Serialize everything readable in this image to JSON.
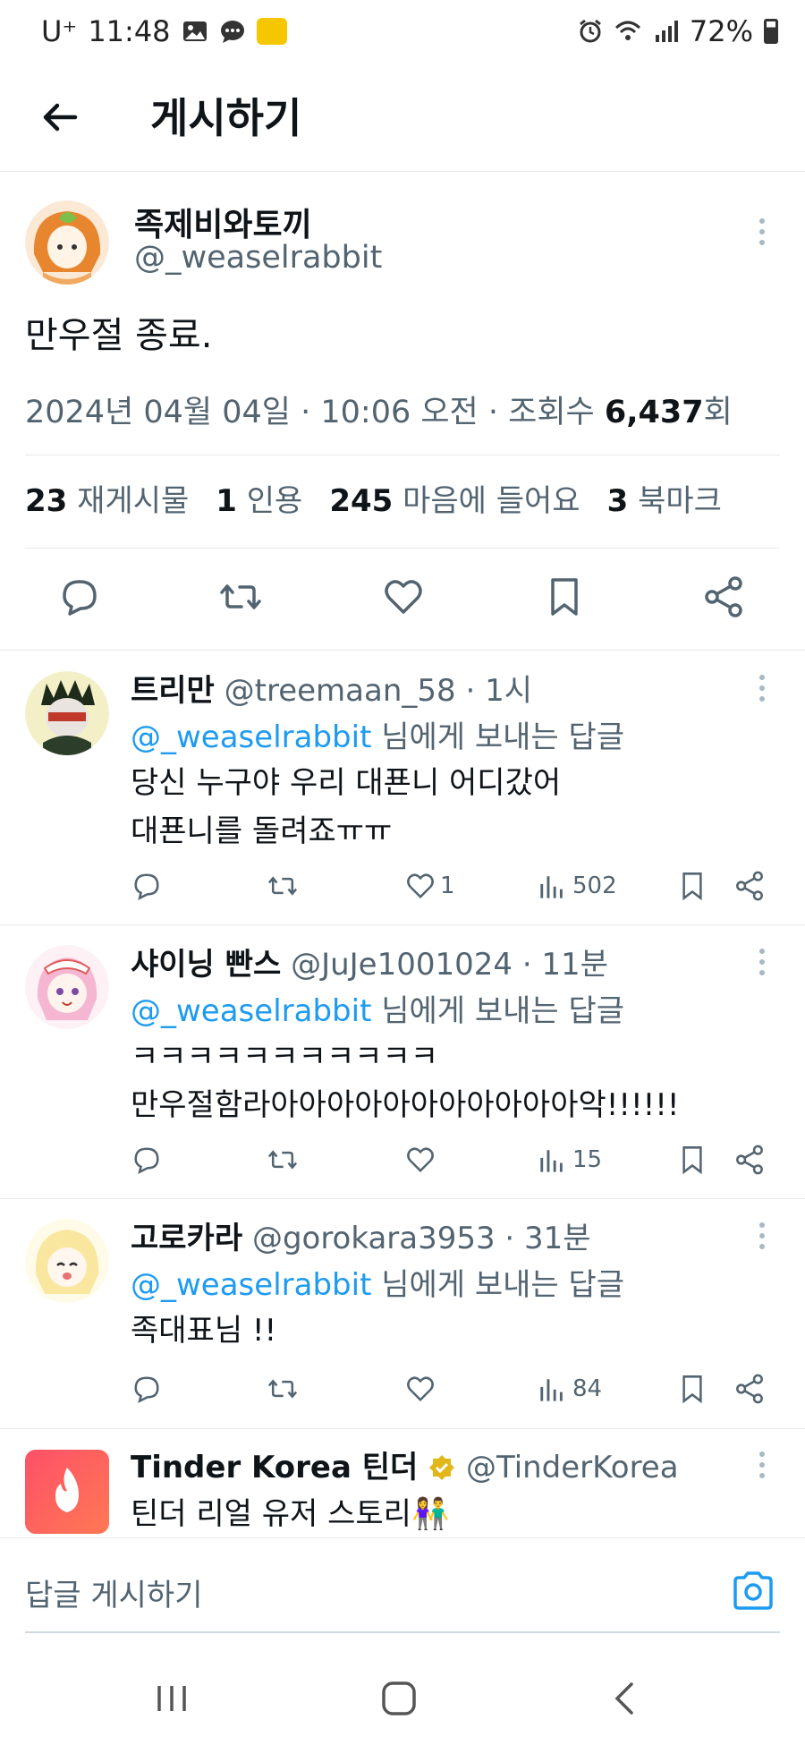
{
  "status_bar": {
    "carrier": "U⁺",
    "time": "11:48",
    "battery": "72%"
  },
  "header": {
    "title": "게시하기"
  },
  "post": {
    "name": "족제비와토끼",
    "handle": "@_weaselrabbit",
    "text": "만우절 종료.",
    "meta_prefix": "2024년 04월 04일 · 10:06 오전 · 조회수 ",
    "views": "6,437",
    "views_suffix": "회",
    "stats": [
      {
        "count": "23",
        "label": "재게시물"
      },
      {
        "count": "1",
        "label": "인용"
      },
      {
        "count": "245",
        "label": "마음에 들어요"
      },
      {
        "count": "3",
        "label": "북마크"
      }
    ]
  },
  "replies": [
    {
      "name": "트리만",
      "meta": "@treemaan_58 · 1시",
      "mention": "@_weaselrabbit",
      "to_suffix": " 님에게 보내는 답글",
      "lines": [
        "당신 누구야 우리 대푠니 어디갔어",
        "대푠니를 돌려죠ㅠㅠ"
      ],
      "likes": "1",
      "views": "502"
    },
    {
      "name": "샤이닝 빤스",
      "meta": "@JuJe1001024 · 11분",
      "mention": "@_weaselrabbit",
      "to_suffix": " 님에게 보내는 답글",
      "lines": [
        "ㅋㅋㅋㅋㅋㅋㅋㅋㅋㅋㅋ",
        "만우절함라아아아아아아아아아아아악!!!!!!"
      ],
      "likes": "",
      "views": "15"
    },
    {
      "name": "고로카라",
      "meta": "@gorokara3953 · 31분",
      "mention": "@_weaselrabbit",
      "to_suffix": " 님에게 보내는 답글",
      "lines": [
        "족대표님 !!"
      ],
      "likes": "",
      "views": "84"
    }
  ],
  "ad": {
    "name": "Tinder Korea 틴더",
    "handle": "@TinderKorea",
    "text": "틴더 리얼 유저 스토리👫"
  },
  "reply_bar": {
    "placeholder": "답글 게시하기"
  },
  "colors": {
    "accent": "#1d9bf0",
    "text": "#0f1419",
    "muted": "#536471"
  }
}
